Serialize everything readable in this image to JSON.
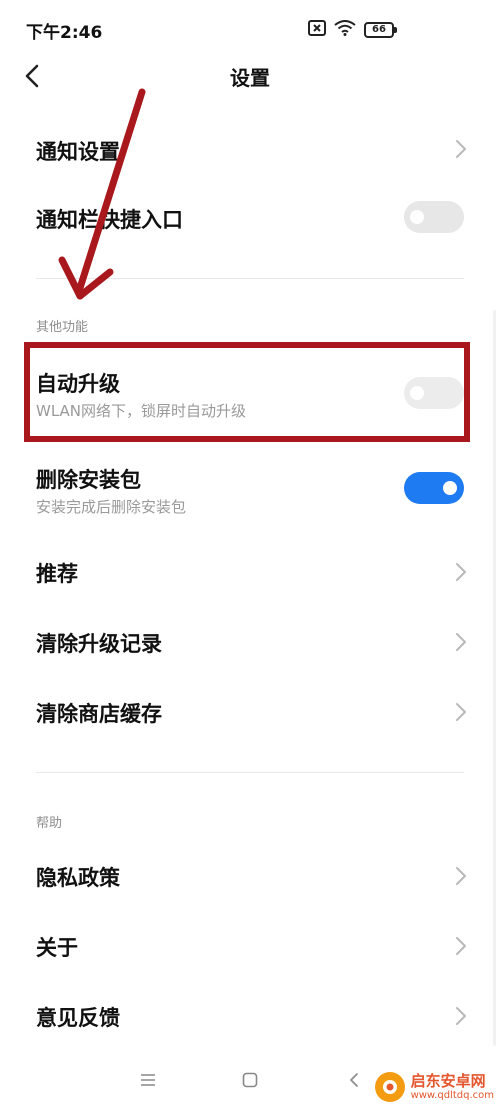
{
  "status_bar": {
    "time": "下午2:46",
    "battery": "66",
    "icons": [
      "sim-off-icon",
      "wifi-icon",
      "battery-icon"
    ]
  },
  "header": {
    "title": "设置"
  },
  "items": {
    "notify_settings": {
      "title": "通知设置",
      "control": "chevron"
    },
    "notify_shortcut": {
      "title": "通知栏快捷入口",
      "control": "toggle",
      "on": false
    },
    "other_label": "其他功能",
    "auto_upgrade": {
      "title": "自动升级",
      "subtitle": "WLAN网络下，锁屏时自动升级",
      "control": "toggle",
      "on": false
    },
    "delete_package": {
      "title": "删除安装包",
      "subtitle": "安装完成后删除安装包",
      "control": "toggle",
      "on": true
    },
    "recommend": {
      "title": "推荐",
      "control": "chevron"
    },
    "clear_upgrade": {
      "title": "清除升级记录",
      "control": "chevron"
    },
    "clear_cache": {
      "title": "清除商店缓存",
      "control": "chevron"
    },
    "help_label": "帮助",
    "privacy": {
      "title": "隐私政策",
      "control": "chevron"
    },
    "about": {
      "title": "关于",
      "control": "chevron"
    },
    "feedback": {
      "title": "意见反馈",
      "control": "chevron"
    }
  },
  "nav_bar": {
    "icons": [
      "menu-icon",
      "home-icon",
      "back-nav-icon"
    ]
  },
  "watermark": {
    "name": "启东安卓网",
    "url": "www.qdltdq.com"
  },
  "colors": {
    "toggle_on": "#1f7bf2",
    "toggle_off": "#e7e7e7",
    "annotation": "#a8181c"
  }
}
